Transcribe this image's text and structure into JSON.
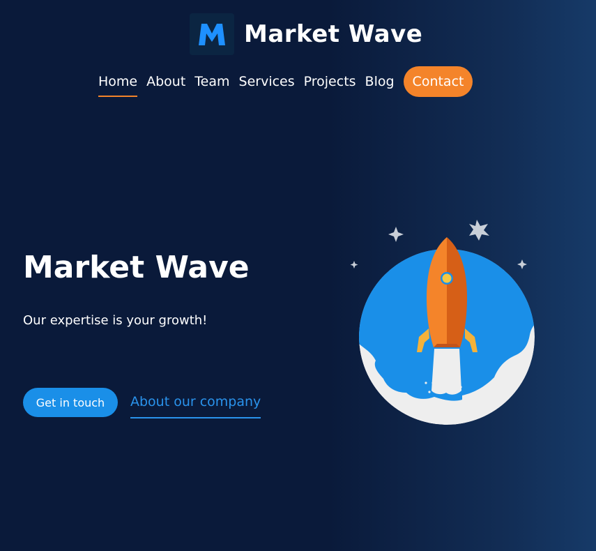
{
  "brand": {
    "logo_letter": "M",
    "name": "Market Wave"
  },
  "nav": {
    "items": [
      {
        "label": "Home",
        "active": true
      },
      {
        "label": "About"
      },
      {
        "label": "Team"
      },
      {
        "label": "Services"
      },
      {
        "label": "Projects"
      },
      {
        "label": "Blog"
      }
    ],
    "contact_label": "Contact"
  },
  "hero": {
    "title": "Market Wave",
    "subtitle": "Our expertise is your growth!",
    "primary_cta": "Get in touch",
    "secondary_cta": "About our company"
  },
  "icons": {
    "logo": "m-logo-icon",
    "illustration": "rocket-launch-icon",
    "decor": "sparkle-star-icon"
  },
  "colors": {
    "background": "#0a1a3a",
    "accent_orange": "#f4842a",
    "accent_blue": "#1a8fe8",
    "logo_blue": "#1e90ff"
  }
}
